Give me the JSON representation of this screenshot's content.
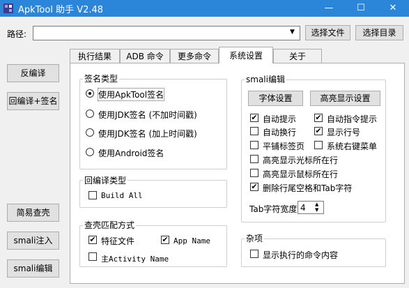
{
  "window": {
    "title": "ApkTool 助手 V2.48",
    "controls": [
      "—",
      "☐",
      "✕"
    ]
  },
  "path": {
    "label": "路径:",
    "value": "",
    "select_file": "选择文件",
    "select_dir": "选择目录"
  },
  "left_buttons": {
    "decompile": "反编译",
    "recompile_sign": "回编译+签名",
    "simple_unpack": "简易查壳",
    "smali_inject": "smali注入",
    "smali_edit": "smali编辑"
  },
  "tabs": [
    "执行结果",
    "ADB 命令",
    "更多命令",
    "系统设置",
    "关于"
  ],
  "active_tab": 3,
  "sign_type": {
    "title": "签名类型",
    "options": [
      "使用ApkTool签名",
      "使用JDK签名 (不加时间戳)",
      "使用JDK签名 (加上时间戳)",
      "使用Android签名"
    ],
    "selected": 0
  },
  "recompile_type": {
    "title": "回编译类型",
    "build_all": "Build All",
    "build_all_checked": false
  },
  "match_mode": {
    "title": "查壳匹配方式",
    "feature_file": "特征文件",
    "feature_file_checked": true,
    "app_name": "App Name",
    "app_name_checked": true,
    "main_activity": "主Activity Name",
    "main_activity_checked": false
  },
  "smali_editor": {
    "title": "smali编辑",
    "font_settings": "字体设置",
    "highlight_settings": "高亮显示设置",
    "options": [
      {
        "label": "自动提示",
        "checked": true
      },
      {
        "label": "自动指令提示",
        "checked": true
      },
      {
        "label": "自动换行",
        "checked": false
      },
      {
        "label": "显示行号",
        "checked": true
      },
      {
        "label": "平铺标签页",
        "checked": false
      },
      {
        "label": "系统右键菜单",
        "checked": false
      },
      {
        "label": "高亮显示光标所在行",
        "checked": false
      },
      {
        "label": "高亮显示鼠标所在行",
        "checked": false
      },
      {
        "label": "删除行尾空格和Tab字符",
        "checked": true
      }
    ],
    "tab_width_label": "Tab字符宽度",
    "tab_width_value": "4"
  },
  "misc": {
    "title": "杂项",
    "show_command": "显示执行的命令内容",
    "show_command_checked": false
  },
  "icons": {
    "checkmark": "✔",
    "dropdown": "▼",
    "spin_up": "▲",
    "spin_down": "▼"
  }
}
